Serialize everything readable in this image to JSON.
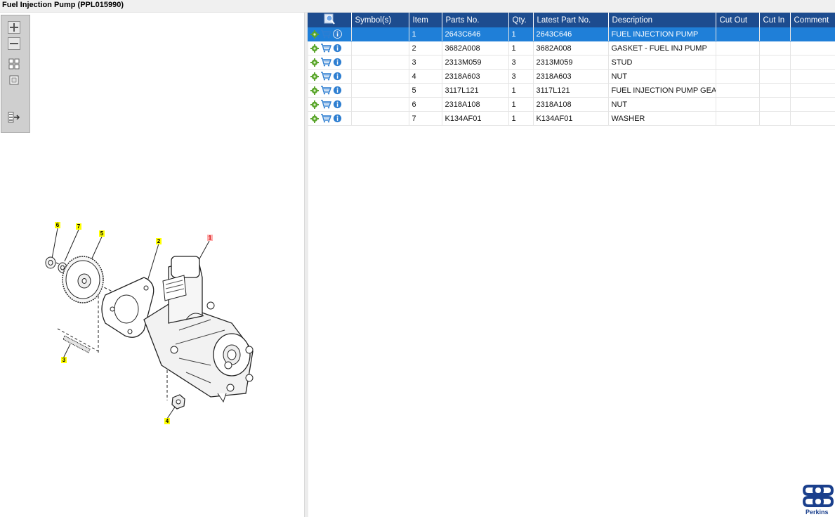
{
  "window": {
    "title": "Fuel Injection Pump (PPL015990)"
  },
  "toolbar": {
    "buttons": [
      {
        "name": "zoom-in-icon"
      },
      {
        "name": "zoom-out-icon"
      },
      {
        "name": "fit-all-icon"
      },
      {
        "name": "fit-window-icon"
      },
      {
        "name": "toggle-panel-icon"
      }
    ]
  },
  "diagram": {
    "callouts": [
      "6",
      "7",
      "5",
      "2",
      "1",
      "3",
      "4"
    ]
  },
  "table": {
    "headers": {
      "actions": "",
      "symbols": "Symbol(s)",
      "item": "Item",
      "part_no": "Parts No.",
      "qty": "Qty.",
      "latest": "Latest Part No.",
      "description": "Description",
      "cut_out": "Cut Out",
      "cut_in": "Cut In",
      "comment": "Comment"
    },
    "rows": [
      {
        "item": "1",
        "part_no": "2643C646",
        "qty": "1",
        "latest": "2643C646",
        "description": "FUEL INJECTION PUMP",
        "symbols": "",
        "cut_out": "",
        "cut_in": "",
        "comment": "",
        "selected": true
      },
      {
        "item": "2",
        "part_no": "3682A008",
        "qty": "1",
        "latest": "3682A008",
        "description": "GASKET - FUEL INJ PUMP",
        "symbols": "",
        "cut_out": "",
        "cut_in": "",
        "comment": "",
        "selected": false
      },
      {
        "item": "3",
        "part_no": "2313M059",
        "qty": "3",
        "latest": "2313M059",
        "description": "STUD",
        "symbols": "",
        "cut_out": "",
        "cut_in": "",
        "comment": "",
        "selected": false
      },
      {
        "item": "4",
        "part_no": "2318A603",
        "qty": "3",
        "latest": "2318A603",
        "description": "NUT",
        "symbols": "",
        "cut_out": "",
        "cut_in": "",
        "comment": "",
        "selected": false
      },
      {
        "item": "5",
        "part_no": "3117L121",
        "qty": "1",
        "latest": "3117L121",
        "description": "FUEL INJECTION PUMP GEAR",
        "symbols": "",
        "cut_out": "",
        "cut_in": "",
        "comment": "",
        "selected": false
      },
      {
        "item": "6",
        "part_no": "2318A108",
        "qty": "1",
        "latest": "2318A108",
        "description": "NUT",
        "symbols": "",
        "cut_out": "",
        "cut_in": "",
        "comment": "",
        "selected": false
      },
      {
        "item": "7",
        "part_no": "K134AF01",
        "qty": "1",
        "latest": "K134AF01",
        "description": "WASHER",
        "symbols": "",
        "cut_out": "",
        "cut_in": "",
        "comment": "",
        "selected": false
      }
    ]
  },
  "brand": {
    "name": "Perkins",
    "color": "#1a3f8c"
  },
  "colors": {
    "header_bg": "#1d4c8f",
    "selected_row": "#1f7fd8",
    "callout": "#ffff00"
  }
}
